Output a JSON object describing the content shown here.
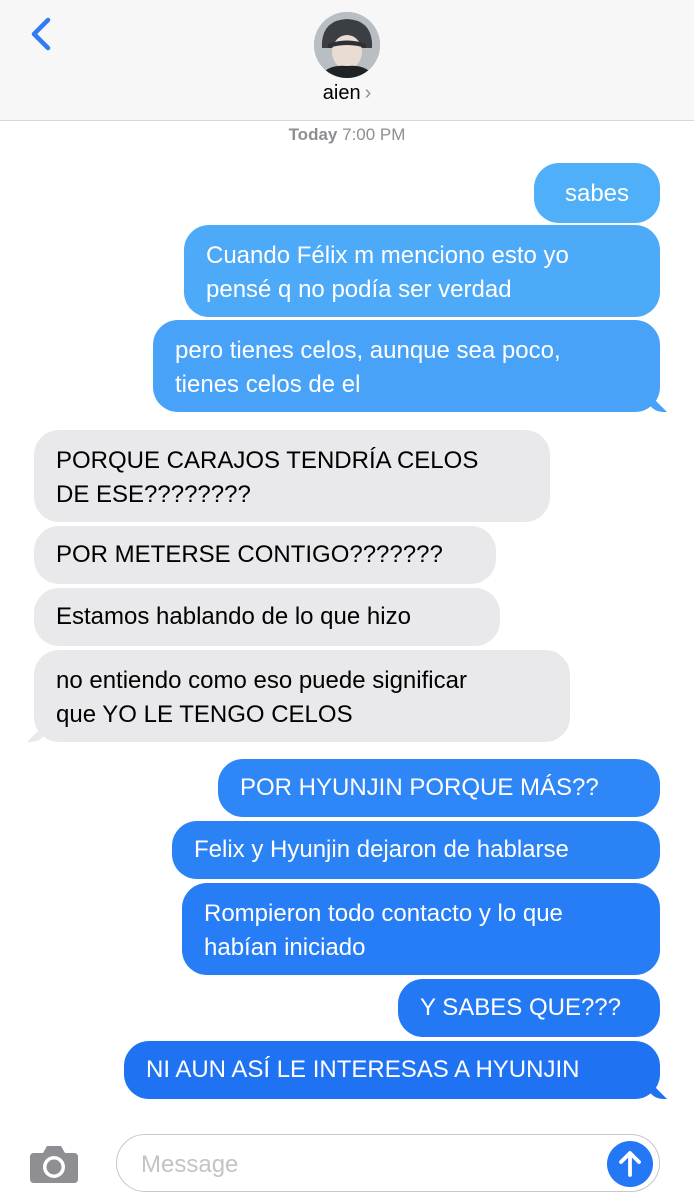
{
  "colors": {
    "accent": "#2f7cf6",
    "sent_light": "#4aa8f8",
    "sent_dark": "#1f6ef3",
    "received": "#e9e9eb",
    "header_bg": "#f7f7f7",
    "timestamp": "#8e8e93"
  },
  "header": {
    "back_icon": "chevron-left-icon",
    "contact_name": "aien",
    "chevron": "›"
  },
  "timestamp": {
    "day": "Today",
    "time": "7:00 PM"
  },
  "messages": [
    {
      "from": "me",
      "text": "sabes"
    },
    {
      "from": "me",
      "lines": [
        "Cuando Félix m menciono esto yo",
        "pensé q no podía ser verdad"
      ]
    },
    {
      "from": "me",
      "lines": [
        "pero tienes celos, aunque sea poco,",
        "tienes celos de el"
      ]
    },
    {
      "from": "them",
      "lines": [
        "PORQUE CARAJOS TENDRÍA CELOS",
        "DE ESE????????"
      ]
    },
    {
      "from": "them",
      "text": "POR METERSE CONTIGO???????"
    },
    {
      "from": "them",
      "text": "Estamos hablando de lo que hizo"
    },
    {
      "from": "them",
      "lines": [
        "no entiendo como eso puede significar",
        "que YO LE TENGO CELOS"
      ]
    },
    {
      "from": "me",
      "text": "POR HYUNJIN PORQUE MÁS??"
    },
    {
      "from": "me",
      "text": "Felix y Hyunjin dejaron de hablarse"
    },
    {
      "from": "me",
      "lines": [
        "Rompieron todo contacto y lo que",
        "habían iniciado"
      ]
    },
    {
      "from": "me",
      "text": "Y SABES QUE???"
    },
    {
      "from": "me",
      "text": "NI AUN ASÍ LE INTERESAS A HYUNJIN"
    }
  ],
  "composer": {
    "camera_icon": "camera-icon",
    "placeholder": "Message",
    "send_icon": "arrow-up-icon"
  }
}
